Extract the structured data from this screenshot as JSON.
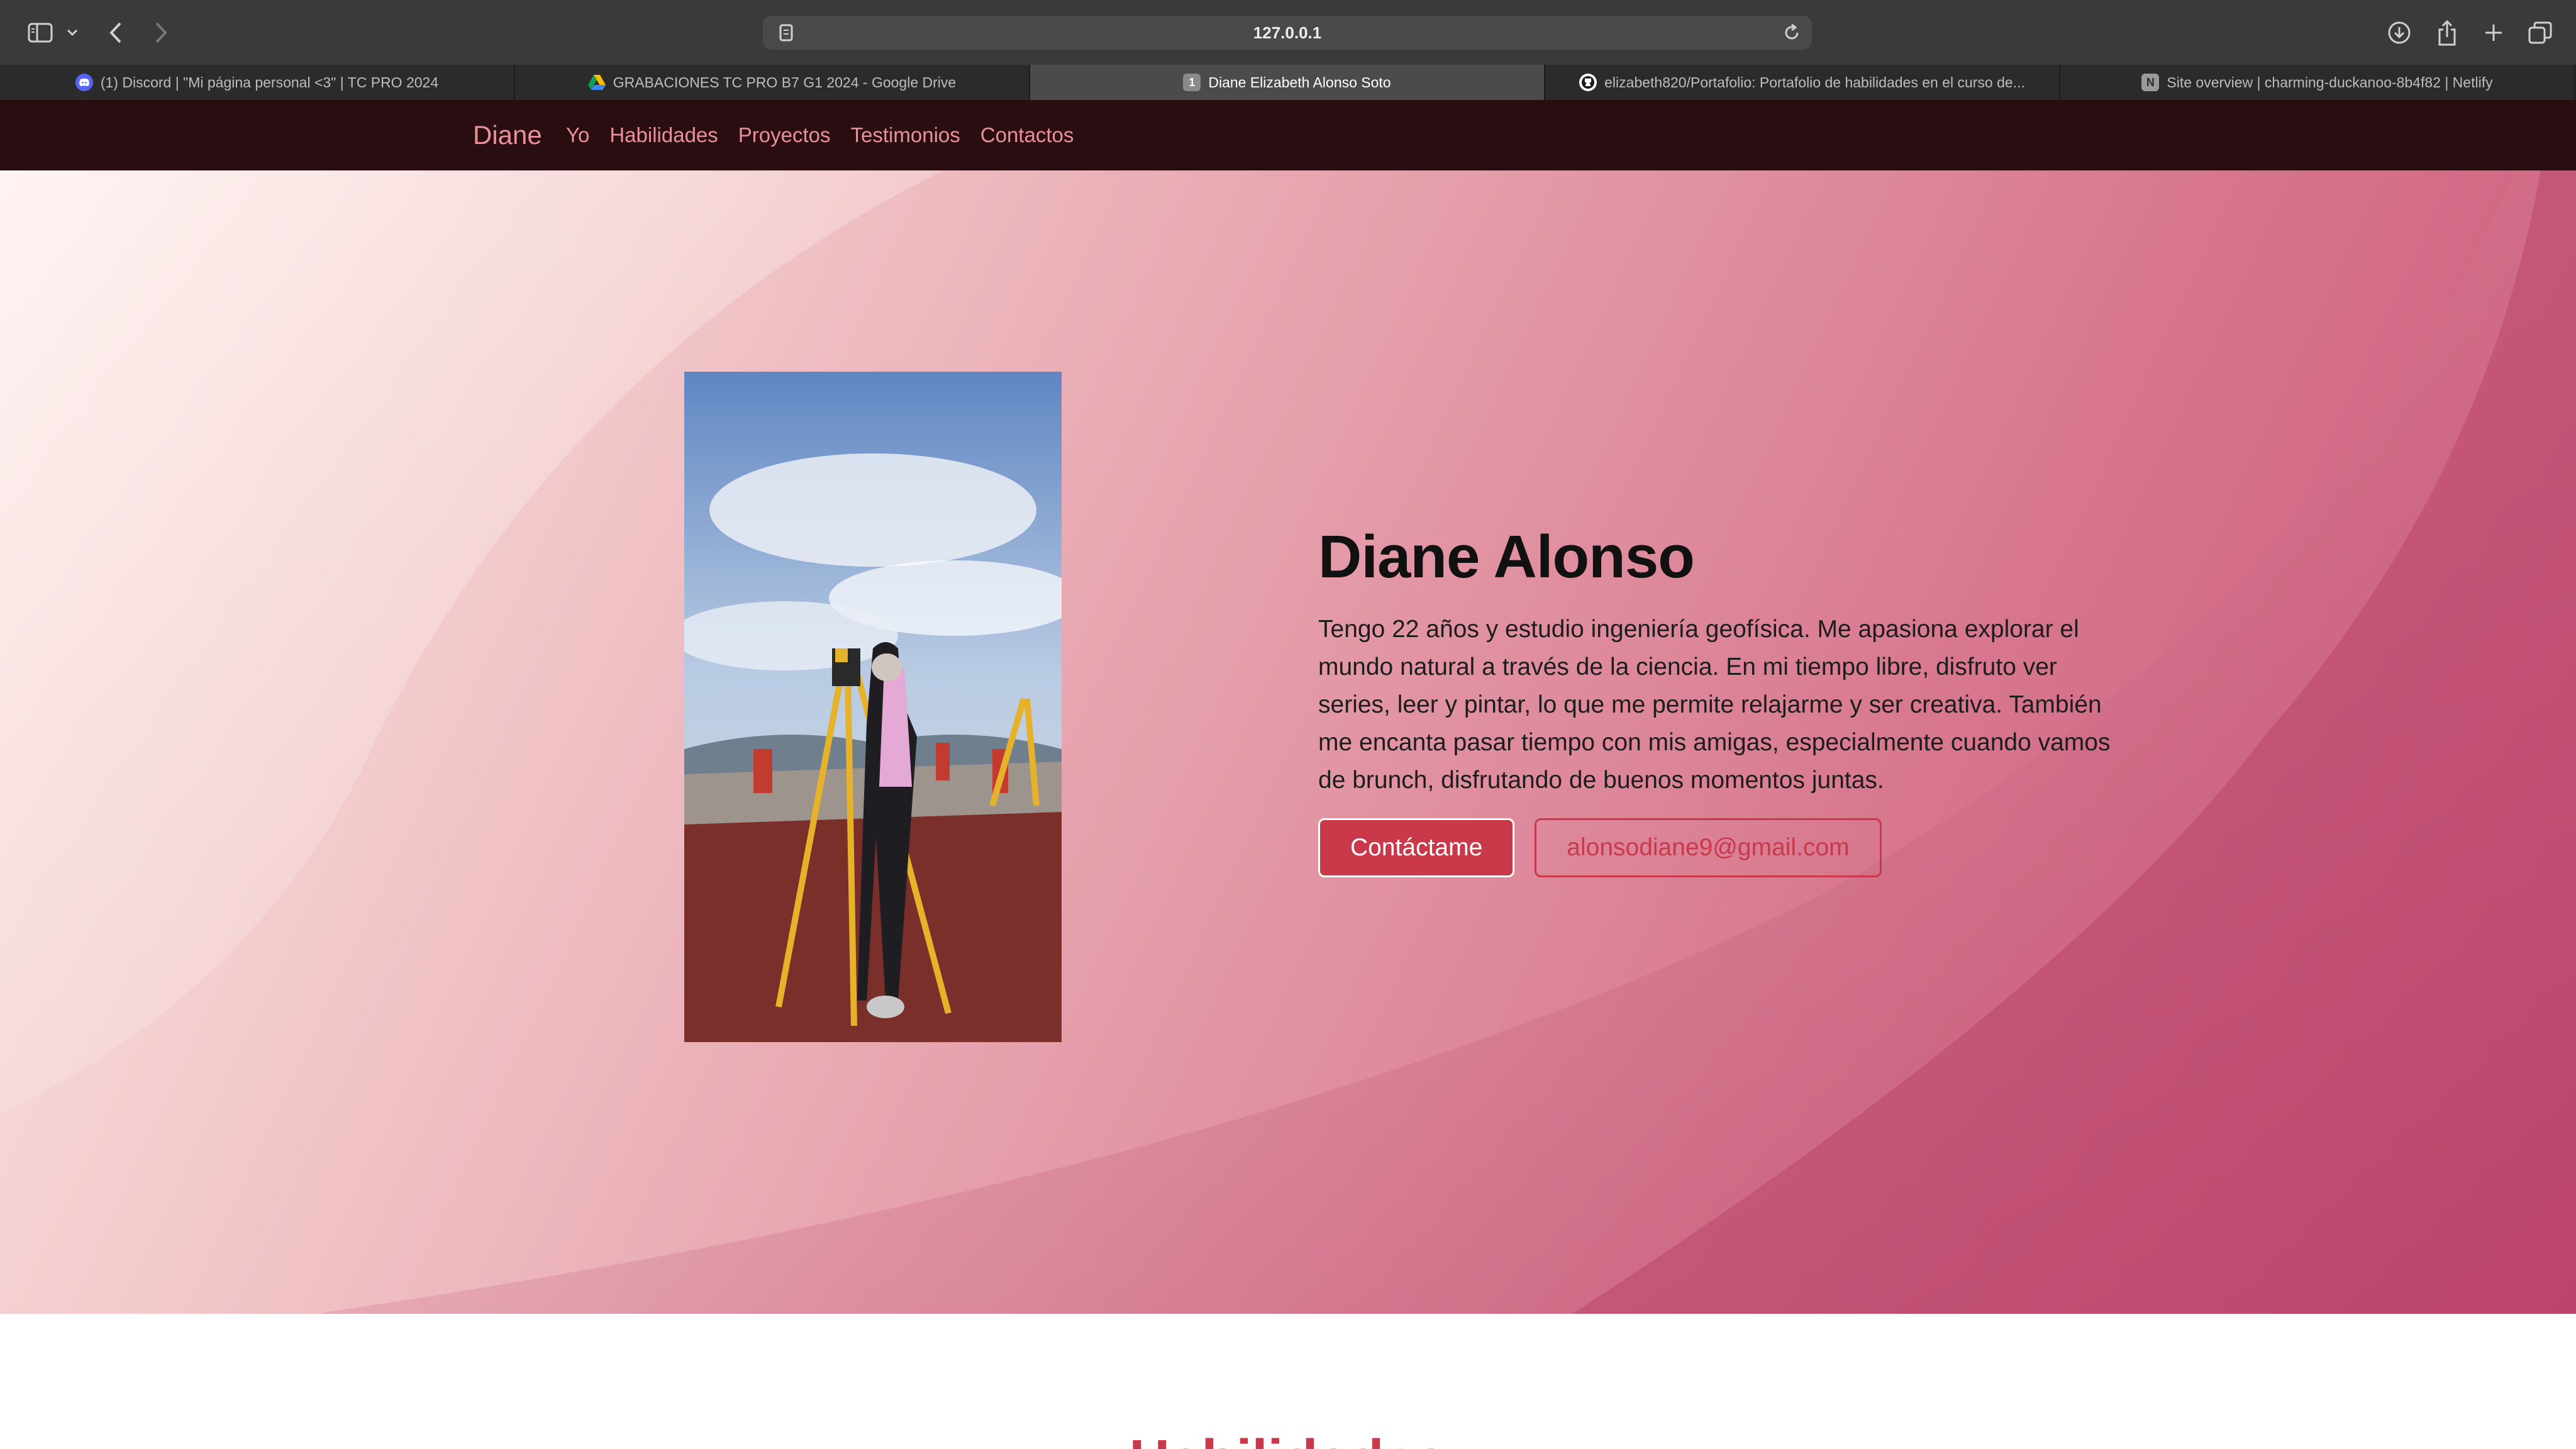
{
  "browser": {
    "address": "127.0.0.1",
    "tabs": [
      {
        "label": "(1) Discord | \"Mi página personal <3\" | TC PRO 2024",
        "icon": "discord-icon",
        "active": false
      },
      {
        "label": "GRABACIONES TC PRO B7 G1 2024 - Google Drive",
        "icon": "google-drive-icon",
        "active": false
      },
      {
        "label": "Diane Elizabeth Alonso Soto",
        "icon": "page-icon",
        "icon_text": "1",
        "active": true
      },
      {
        "label": "elizabeth820/Portafolio: Portafolio de habilidades en el curso de...",
        "icon": "github-icon",
        "active": false
      },
      {
        "label": "Site overview | charming-duckanoo-8b4f82 | Netlify",
        "icon": "netlify-icon",
        "icon_text": "N",
        "active": false
      }
    ]
  },
  "nav": {
    "brand": "Diane",
    "links": [
      "Yo",
      "Habilidades",
      "Proyectos",
      "Testimonios",
      "Contactos"
    ]
  },
  "hero": {
    "title": "Diane Alonso",
    "text": "Tengo 22 años y estudio ingeniería geofísica. Me apasiona explorar el mundo natural a través de la ciencia. En mi tiempo libre, disfruto ver series, leer y pintar, lo que me permite relajarme y ser creativa. También me encanta pasar tiempo con mis amigas, especialmente cuando vamos de brunch, disfrutando de buenos momentos juntas.",
    "primary_button": "Contáctame",
    "email_button": "alonsodiane9@gmail.com"
  },
  "next_section": {
    "title": "Habilidades"
  },
  "colors": {
    "accent": "#c9394a",
    "nav_bg": "#2a0d10",
    "nav_link": "#e9919b"
  }
}
